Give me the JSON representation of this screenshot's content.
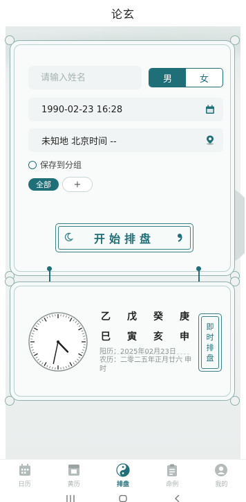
{
  "header": {
    "title": "论玄"
  },
  "form": {
    "name_placeholder": "请输入姓名",
    "gender": {
      "male": "男",
      "female": "女",
      "selected": "男"
    },
    "datetime": "1990-02-23 16:28",
    "location": "未知地 北京时间 --",
    "save_to_group": "保存到分组",
    "groups": [
      "全部"
    ],
    "add_group": "+",
    "start_button": "开始排盘"
  },
  "now_card": {
    "stems": [
      "乙",
      "戊",
      "癸",
      "庚"
    ],
    "branches": [
      "巳",
      "寅",
      "亥",
      "申"
    ],
    "solar": "阳历：2025年02月23日",
    "lunar": "农历：二零二五年正月廿六 申时",
    "now_button": [
      "即",
      "时",
      "排",
      "盘"
    ],
    "clock": {
      "hour": 16,
      "minute": 32
    }
  },
  "tabs": [
    {
      "label": "日历",
      "icon": "calendar-icon",
      "active": false
    },
    {
      "label": "黄历",
      "icon": "almanac-icon",
      "active": false
    },
    {
      "label": "排盘",
      "icon": "yinyang-icon",
      "active": true
    },
    {
      "label": "命例",
      "icon": "clipboard-icon",
      "active": false
    },
    {
      "label": "我的",
      "icon": "user-icon",
      "active": false
    }
  ],
  "colors": {
    "accent": "#1e6f78",
    "frame": "#8fb0ad",
    "background": "#eef2f1"
  }
}
